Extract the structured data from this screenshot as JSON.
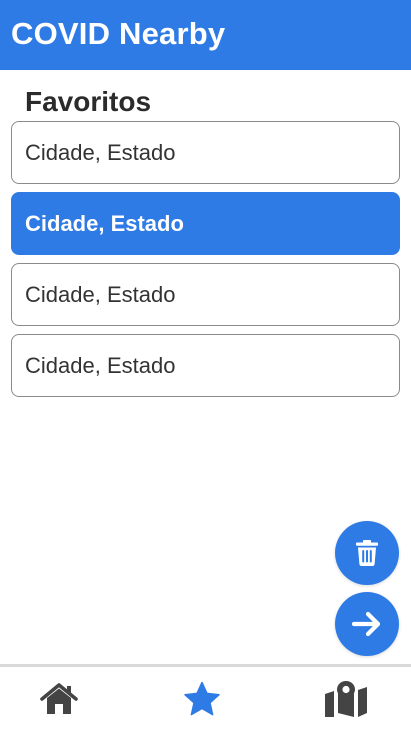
{
  "header": {
    "title": "COVID Nearby",
    "color": "#2f7be5"
  },
  "favorites": {
    "title": "Favoritos",
    "items": [
      {
        "label": "Cidade, Estado",
        "selected": false
      },
      {
        "label": "Cidade, Estado",
        "selected": true
      },
      {
        "label": "Cidade, Estado",
        "selected": false
      },
      {
        "label": "Cidade, Estado",
        "selected": false
      }
    ]
  },
  "actions": {
    "delete_icon": "trash-icon",
    "next_icon": "arrow-right-icon"
  },
  "bottom_nav": {
    "items": [
      {
        "icon": "home-icon",
        "active": false
      },
      {
        "icon": "star-icon",
        "active": true
      },
      {
        "icon": "map-icon",
        "active": false
      }
    ],
    "active_color": "#2f7be5",
    "inactive_color": "#444444"
  }
}
